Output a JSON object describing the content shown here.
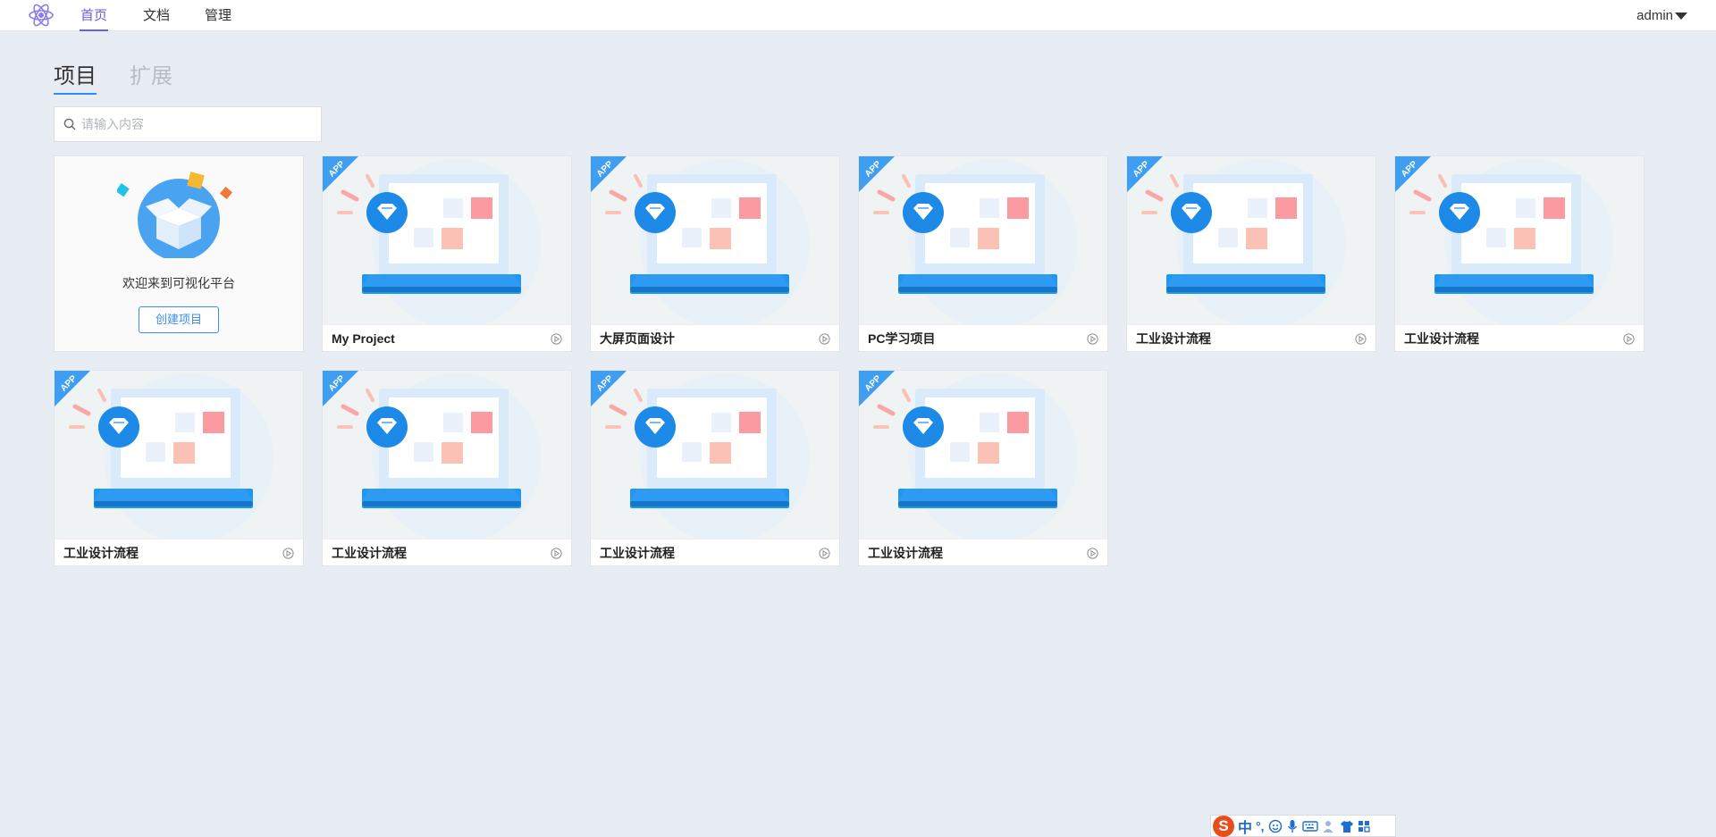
{
  "nav": {
    "items": [
      "首页",
      "文档",
      "管理"
    ],
    "active_index": 0,
    "user": "admin"
  },
  "tabs": [
    {
      "label": "项目",
      "active": true
    },
    {
      "label": "扩展",
      "active": false
    }
  ],
  "search": {
    "placeholder": "请输入内容",
    "value": ""
  },
  "welcome": {
    "text": "欢迎来到可视化平台",
    "button_label": "创建项目"
  },
  "projects": [
    {
      "title": "My Project",
      "badge": "APP"
    },
    {
      "title": "大屏页面设计",
      "badge": "APP"
    },
    {
      "title": "PC学习项目",
      "badge": "APP"
    },
    {
      "title": "工业设计流程",
      "badge": "APP"
    },
    {
      "title": "工业设计流程",
      "badge": "APP"
    },
    {
      "title": "工业设计流程",
      "badge": "APP"
    },
    {
      "title": "工业设计流程",
      "badge": "APP"
    },
    {
      "title": "工业设计流程",
      "badge": "APP"
    },
    {
      "title": "工业设计流程",
      "badge": "APP"
    }
  ],
  "ime_toolbar": {
    "logo": "S",
    "mode": "中",
    "punct": "°,",
    "icons": [
      "emoji-icon",
      "microphone-icon",
      "keyboard-icon",
      "user-icon",
      "shirt-icon",
      "grid-icon"
    ]
  },
  "colors": {
    "accent": "#6c5ce7",
    "primary_blue": "#2b8cff",
    "background": "#e8ecf3",
    "badge_blue": "#3d9ef2"
  }
}
